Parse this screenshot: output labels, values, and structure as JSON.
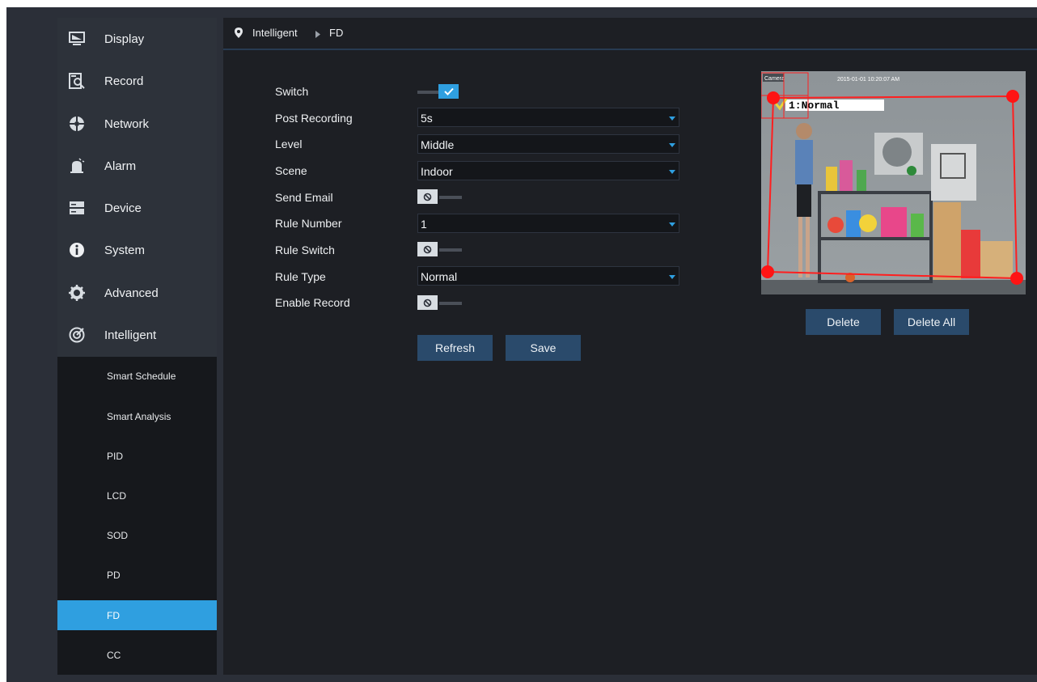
{
  "colors": {
    "accent": "#2f9fe0",
    "roi": "#ff1f1f",
    "button": "#2a4a6b"
  },
  "nav": [
    {
      "label": "Display",
      "icon": "display-icon"
    },
    {
      "label": "Record",
      "icon": "record-icon"
    },
    {
      "label": "Network",
      "icon": "network-icon"
    },
    {
      "label": "Alarm",
      "icon": "alarm-icon"
    },
    {
      "label": "Device",
      "icon": "device-icon"
    },
    {
      "label": "System",
      "icon": "system-icon"
    },
    {
      "label": "Advanced",
      "icon": "advanced-icon"
    },
    {
      "label": "Intelligent",
      "icon": "intelligent-icon"
    }
  ],
  "subnav": {
    "items": [
      "Smart Schedule",
      "Smart Analysis",
      "PID",
      "LCD",
      "SOD",
      "PD",
      "FD",
      "CC"
    ],
    "active": "FD"
  },
  "breadcrumb": {
    "section": "Intelligent",
    "page": "FD"
  },
  "form": {
    "switch": {
      "label": "Switch",
      "on": true
    },
    "post_recording": {
      "label": "Post Recording",
      "value": "5s"
    },
    "level": {
      "label": "Level",
      "value": "Middle"
    },
    "scene": {
      "label": "Scene",
      "value": "Indoor"
    },
    "send_email": {
      "label": "Send Email",
      "on": false
    },
    "rule_number": {
      "label": "Rule Number",
      "value": "1"
    },
    "rule_switch": {
      "label": "Rule Switch",
      "on": false
    },
    "rule_type": {
      "label": "Rule Type",
      "value": "Normal"
    },
    "enable_record": {
      "label": "Enable Record",
      "on": false
    }
  },
  "buttons": {
    "refresh": "Refresh",
    "save": "Save",
    "delete": "Delete",
    "delete_all": "Delete All"
  },
  "preview": {
    "camera_label": "Camera",
    "timestamp": "2015-01-01 10:20:07 AM",
    "rule_tag": "1:Normal"
  }
}
